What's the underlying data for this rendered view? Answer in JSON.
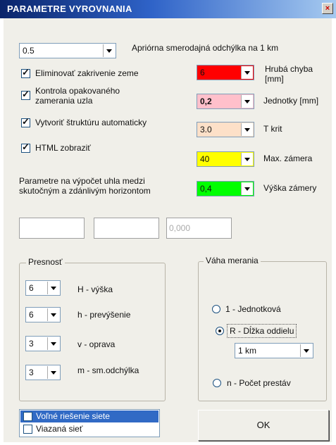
{
  "window": {
    "title": "PARAMETRE VYROVNANIA"
  },
  "apriori": {
    "value": "0.5",
    "label": "Apriórna smerodajná odchýlka na 1 km"
  },
  "checkboxes": [
    {
      "label": "Eliminovať zakrivenie zeme",
      "checked": true
    },
    {
      "label": "Kontrola opakovaného zamerania uzla",
      "checked": true
    },
    {
      "label": "Vytvoriť štruktúru automaticky",
      "checked": true
    },
    {
      "label": "HTML zobraziť",
      "checked": true
    }
  ],
  "color_params": [
    {
      "value": "6",
      "label": "Hrubá chyba [mm]",
      "color": "#ff0000"
    },
    {
      "value": "0,2",
      "label": "Jednotky [mm]",
      "color": "#ffc0cb"
    },
    {
      "value": "3.0",
      "label": "T krit",
      "color": "#fde0c8"
    },
    {
      "value": "40",
      "label": "Max. zámera",
      "color": "#ffff00"
    },
    {
      "value": "0,4",
      "label": "Výška zámery",
      "color": "#00ff00"
    }
  ],
  "angle_params": {
    "label": "Parametre na výpočet uhla medzi skutočným a zdánlivým horizontom",
    "fields": [
      "",
      "",
      "0,000"
    ]
  },
  "presnost": {
    "title": "Presnosť",
    "rows": [
      {
        "value": "6",
        "label": "H - výška"
      },
      {
        "value": "6",
        "label": "h - prevýšenie"
      },
      {
        "value": "3",
        "label": "v - oprava"
      },
      {
        "value": "3",
        "label": "m - sm.odchýlka"
      }
    ]
  },
  "vaha": {
    "title": "Váha merania",
    "options": [
      {
        "label": "1 - Jednotková",
        "selected": false
      },
      {
        "label": "R - Dĺžka oddielu",
        "selected": true
      },
      {
        "label": "n - Počet prestáv",
        "selected": false
      }
    ],
    "length_value": "1 km"
  },
  "solution_list": [
    {
      "label": "Voľné riešenie siete",
      "selected": true
    },
    {
      "label": "Viazaná sieť",
      "selected": false
    }
  ],
  "ok_button": "OK"
}
